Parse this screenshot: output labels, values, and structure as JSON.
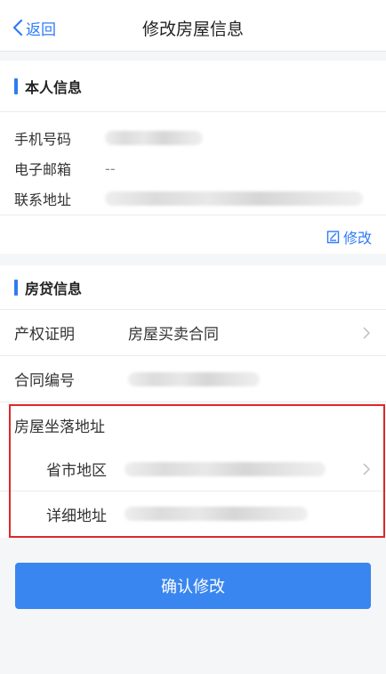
{
  "nav": {
    "back_label": "返回",
    "title": "修改房屋信息"
  },
  "personal": {
    "title": "本人信息",
    "rows": [
      {
        "label": "手机号码",
        "value": ""
      },
      {
        "label": "电子邮箱",
        "value": "--"
      },
      {
        "label": "联系地址",
        "value": ""
      }
    ],
    "edit_label": "修改"
  },
  "loan": {
    "title": "房贷信息",
    "property_cert": {
      "label": "产权证明",
      "value": "房屋买卖合同"
    },
    "contract_no": {
      "label": "合同编号"
    },
    "address": {
      "title": "房屋坐落地址",
      "region_label": "省市地区",
      "detail_label": "详细地址"
    }
  },
  "confirm_label": "确认修改",
  "colors": {
    "accent": "#2f7bf6",
    "button": "#3a86f0",
    "highlight_border": "#e02727"
  }
}
